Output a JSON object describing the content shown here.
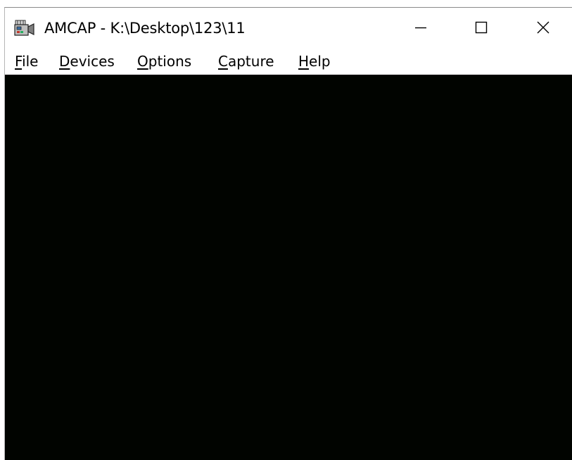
{
  "window": {
    "title": "AMCAP - K:\\Desktop\\123\\11",
    "icon": "camera-icon"
  },
  "caption_buttons": {
    "minimize": "minimize-icon",
    "maximize": "maximize-icon",
    "close": "close-icon"
  },
  "menu": {
    "file": {
      "accel": "F",
      "rest": "ile"
    },
    "devices": {
      "accel": "D",
      "rest": "evices"
    },
    "options": {
      "accel": "O",
      "rest": "ptions"
    },
    "capture": {
      "accel": "C",
      "rest": "apture"
    },
    "help": {
      "accel": "H",
      "rest": "elp"
    }
  },
  "colors": {
    "titlebar_bg": "#ffffff",
    "preview_bg": "#000000",
    "text": "#000000"
  }
}
